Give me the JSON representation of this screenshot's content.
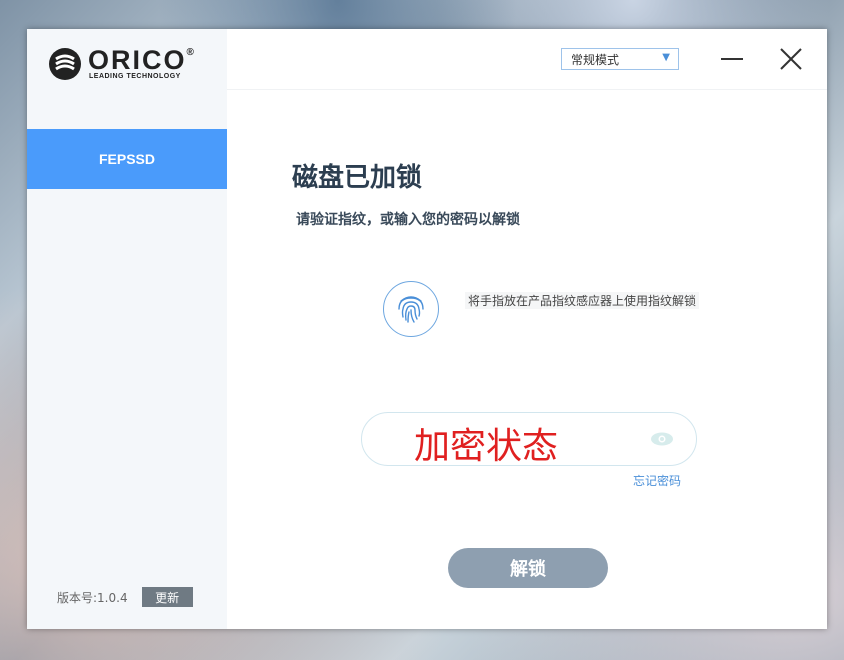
{
  "brand": {
    "name": "ORICO",
    "tagline": "LEADING TECHNOLOGY",
    "mark": "®"
  },
  "sidebar": {
    "items": [
      {
        "label": "FEPSSD"
      }
    ],
    "version_label": "版本号:1.0.4",
    "update_label": "更新"
  },
  "header": {
    "mode_select": {
      "value": "常规模式",
      "arrow": "▼"
    }
  },
  "main": {
    "title": "磁盘已加锁",
    "subtitle": "请验证指纹，或输入您的密码以解锁",
    "fingerprint_hint": "将手指放在产品指纹感应器上使用指纹解锁",
    "password_value": "加密状态",
    "forgot_password": "忘记密码",
    "unlock_button": "解锁"
  },
  "colors": {
    "accent": "#4a9bfb",
    "unlock_button": "#8e9fb0",
    "password_text": "#e02020",
    "link": "#4a8fd8"
  },
  "icons": [
    "orico-logo-icon",
    "minimize-icon",
    "close-icon",
    "fingerprint-icon",
    "eye-icon",
    "dropdown-arrow-icon"
  ]
}
